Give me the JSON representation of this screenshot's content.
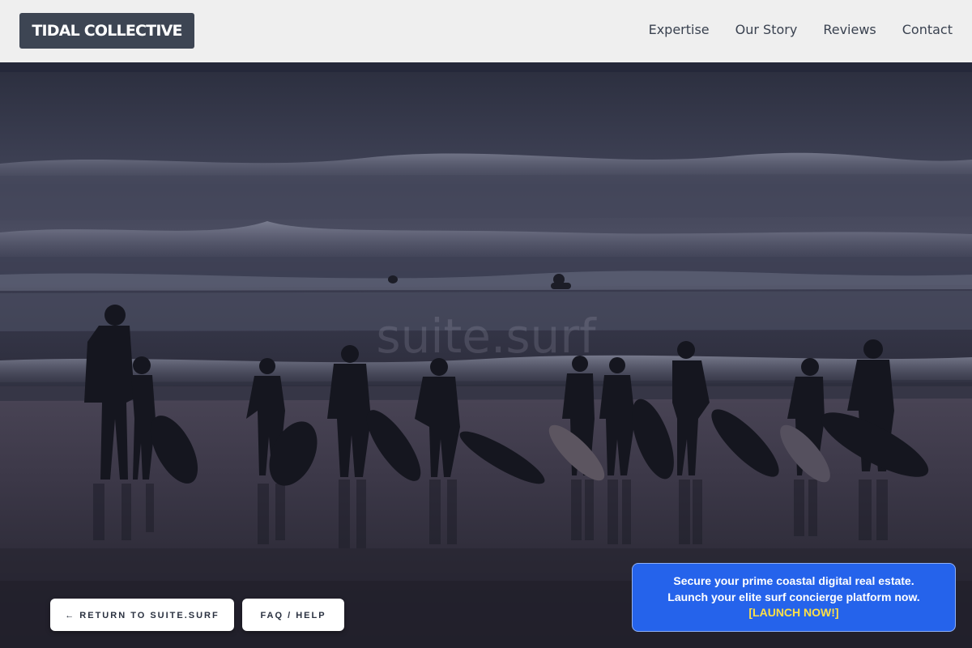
{
  "header": {
    "logo": "TIDAL COLLECTIVE",
    "nav": [
      "Expertise",
      "Our Story",
      "Reviews",
      "Contact"
    ]
  },
  "hero": {
    "watermark": "suite.surf"
  },
  "buttons": {
    "return_label": "← RETURN TO SUITE.SURF",
    "faq_label": "FAQ / HELP"
  },
  "promo": {
    "line1": "Secure your prime coastal digital real estate.",
    "line2": "Launch your elite surf concierge platform now.",
    "cta": "[LAUNCH NOW!]"
  },
  "colors": {
    "header_bg": "#efefef",
    "logo_bg": "#3d4553",
    "promo_bg": "#2563eb",
    "promo_cta": "#fde047"
  }
}
